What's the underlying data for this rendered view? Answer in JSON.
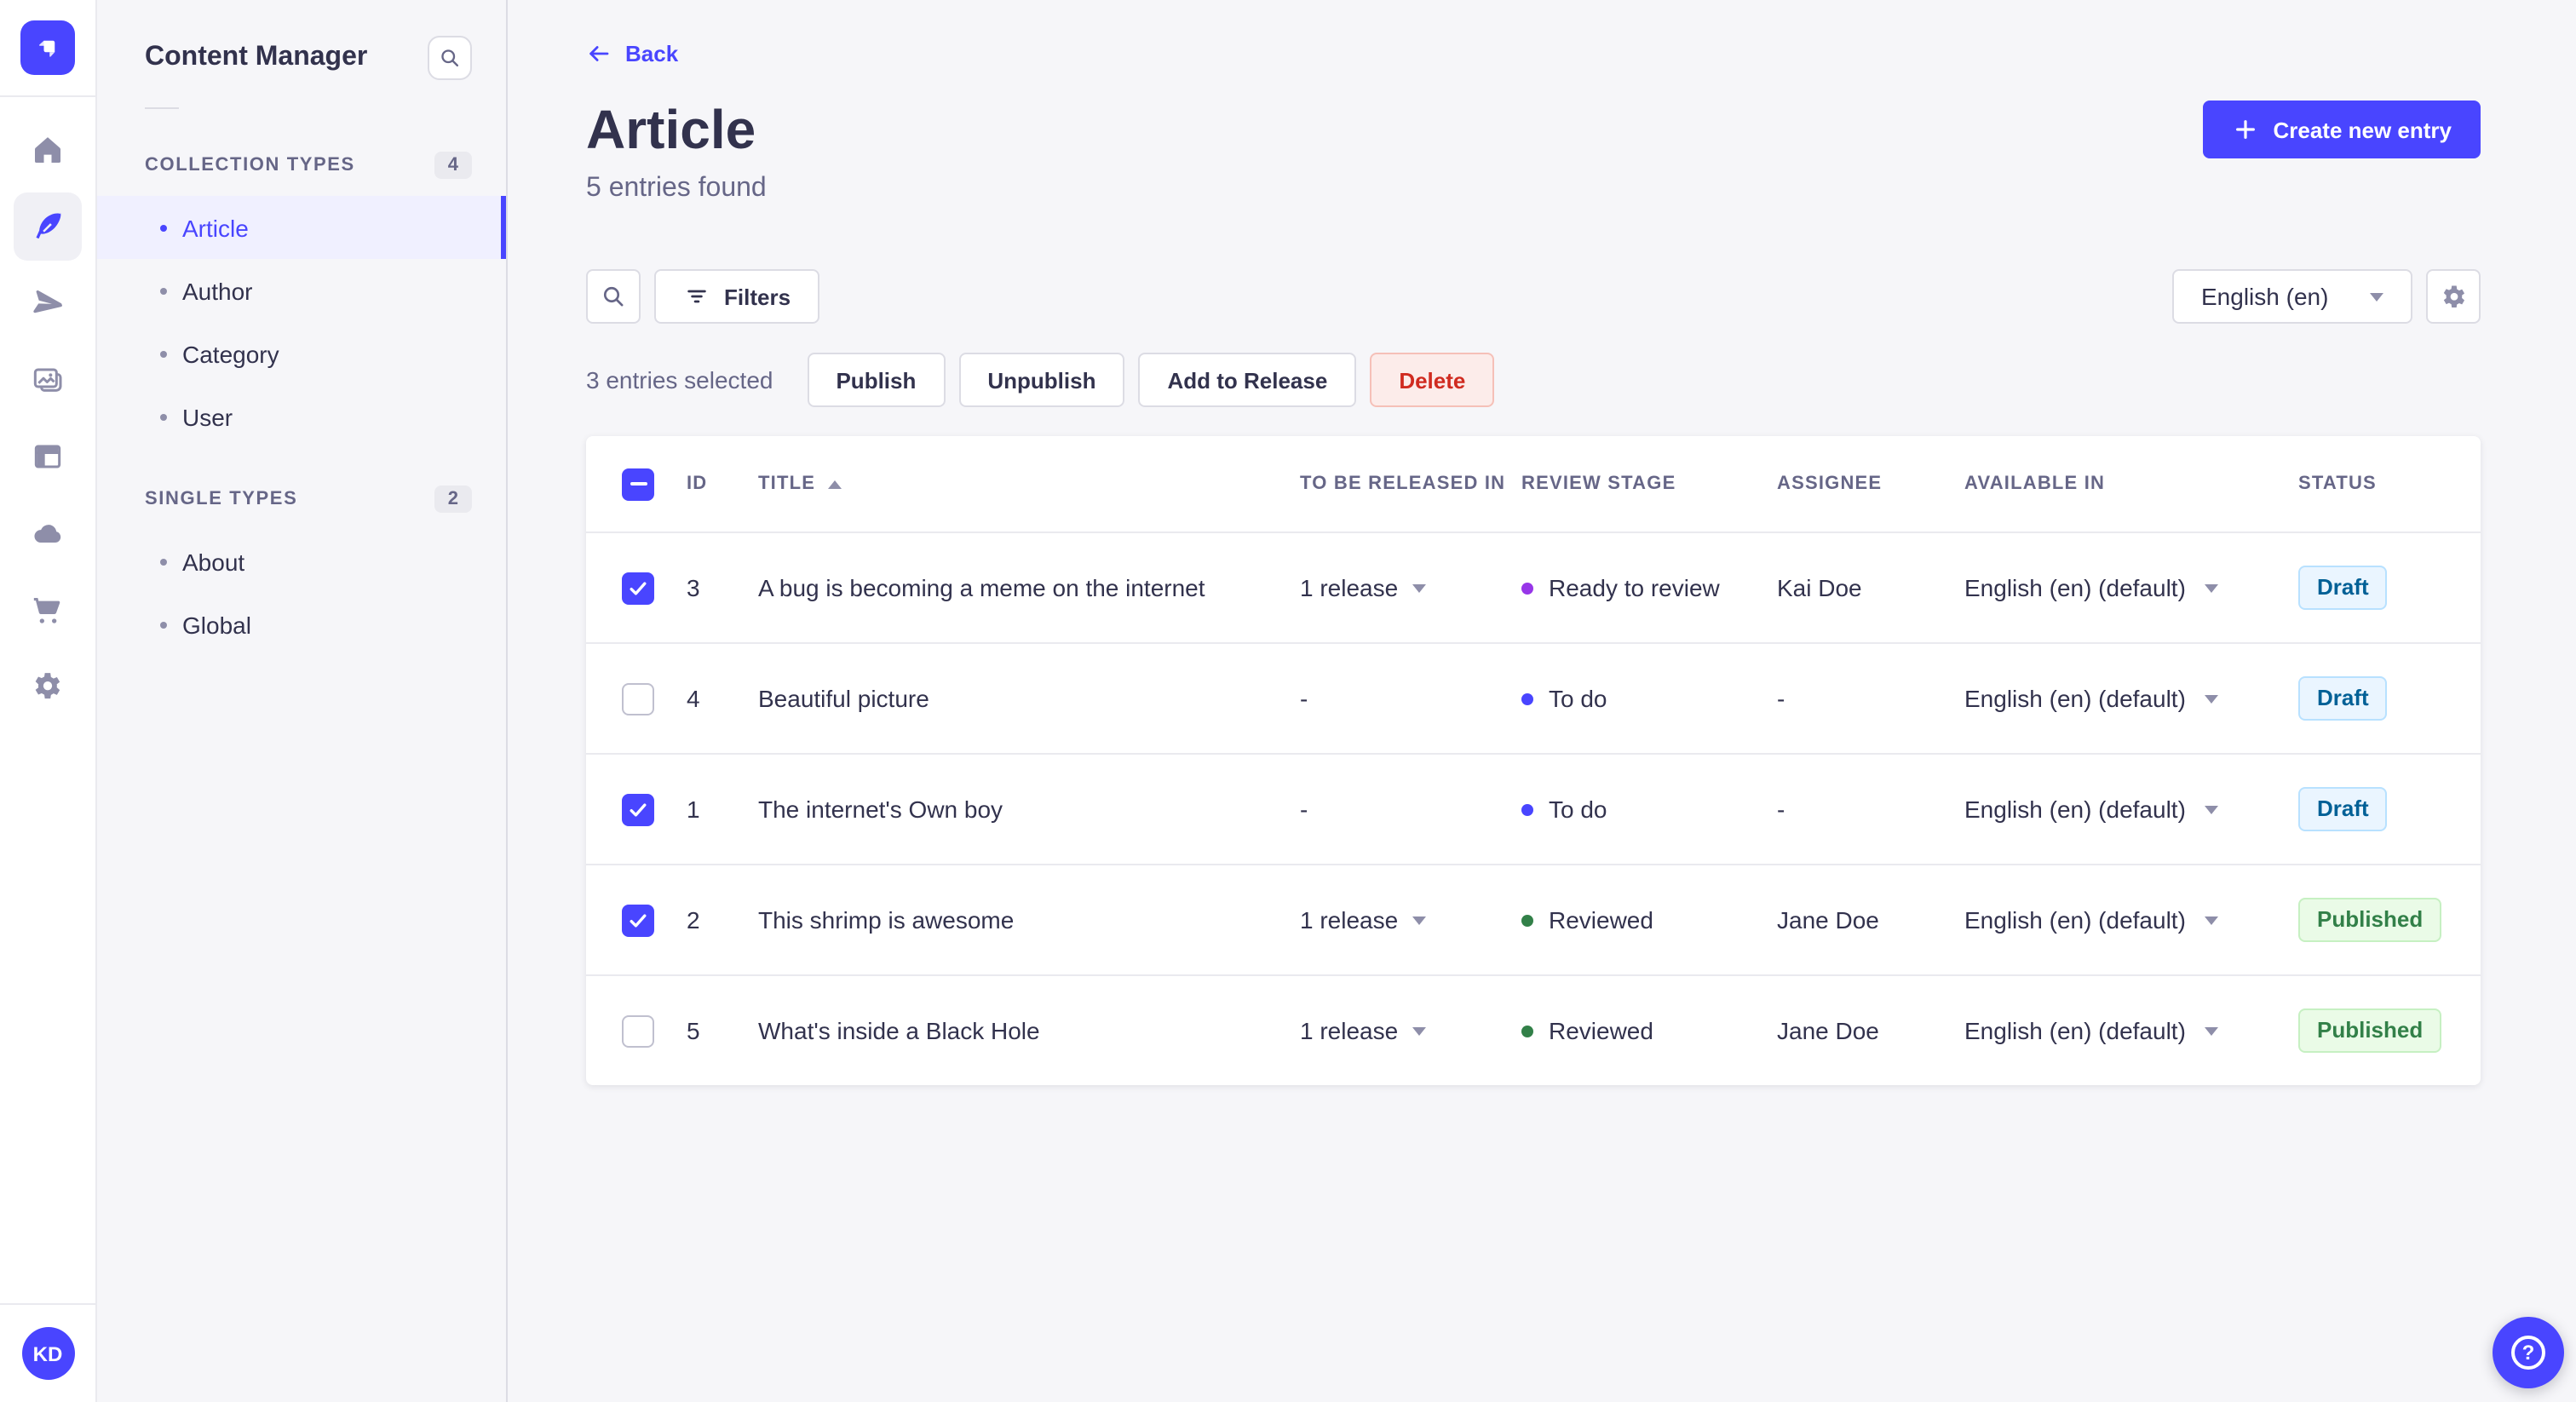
{
  "app": {
    "name": "Content Manager",
    "brand_color": "#4945ff"
  },
  "rail": {
    "items": [
      "home",
      "content-manager",
      "releases",
      "media-library",
      "content-type-builder",
      "deploy",
      "marketplace",
      "settings"
    ],
    "active_item": "content-manager",
    "avatar_initials": "KD"
  },
  "sidebar": {
    "title": "Content Manager",
    "collection": {
      "label": "COLLECTION TYPES",
      "count": "4",
      "items": [
        {
          "label": "Article",
          "state": "active"
        },
        {
          "label": "Author",
          "state": ""
        },
        {
          "label": "Category",
          "state": ""
        },
        {
          "label": "User",
          "state": ""
        }
      ]
    },
    "single": {
      "label": "SINGLE TYPES",
      "count": "2",
      "items": [
        {
          "label": "About",
          "state": ""
        },
        {
          "label": "Global",
          "state": ""
        }
      ]
    }
  },
  "header": {
    "back_label": "Back",
    "title": "Article",
    "subtitle": "5 entries found",
    "create_label": "Create new entry"
  },
  "toolbar": {
    "filters_label": "Filters",
    "locale_value": "English (en)"
  },
  "selection": {
    "summary": "3 entries selected",
    "publish_label": "Publish",
    "unpublish_label": "Unpublish",
    "add_to_release_label": "Add to Release",
    "delete_label": "Delete"
  },
  "table": {
    "headers": {
      "id": "ID",
      "title": "TITLE",
      "released": "TO BE RELEASED IN",
      "review": "REVIEW STAGE",
      "assignee": "ASSIGNEE",
      "available": "AVAILABLE IN",
      "status": "STATUS"
    },
    "sort": {
      "column": "TITLE",
      "direction": "asc"
    },
    "rows": [
      {
        "checked": true,
        "id": "3",
        "title": "A bug is becoming a meme on the internet",
        "release": "1 release",
        "release_menu": true,
        "stage": "Ready to review",
        "stage_color": "#9736e8",
        "assignee": "Kai Doe",
        "locale": "English (en) (default)",
        "status": "Draft",
        "status_variant": "draft"
      },
      {
        "checked": false,
        "id": "4",
        "title": "Beautiful picture",
        "release": "-",
        "release_menu": false,
        "stage": "To do",
        "stage_color": "#4945ff",
        "assignee": "-",
        "locale": "English (en) (default)",
        "status": "Draft",
        "status_variant": "draft"
      },
      {
        "checked": true,
        "id": "1",
        "title": "The internet's Own boy",
        "release": "-",
        "release_menu": false,
        "stage": "To do",
        "stage_color": "#4945ff",
        "assignee": "-",
        "locale": "English (en) (default)",
        "status": "Draft",
        "status_variant": "draft"
      },
      {
        "checked": true,
        "id": "2",
        "title": "This shrimp is awesome",
        "release": "1 release",
        "release_menu": true,
        "stage": "Reviewed",
        "stage_color": "#328048",
        "assignee": "Jane Doe",
        "locale": "English (en) (default)",
        "status": "Published",
        "status_variant": "published"
      },
      {
        "checked": false,
        "id": "5",
        "title": "What's inside a Black Hole",
        "release": "1 release",
        "release_menu": true,
        "stage": "Reviewed",
        "stage_color": "#328048",
        "assignee": "Jane Doe",
        "locale": "English (en) (default)",
        "status": "Published",
        "status_variant": "published"
      }
    ]
  },
  "fab": {
    "help_glyph": "?"
  },
  "colors": {
    "accent": "#4945ff",
    "sidebar_active_bg": "#f0f0ff",
    "danger_text": "#d02b20",
    "danger_bg": "#fcecea",
    "danger_border": "#f5c0b8",
    "draft_text": "#006096",
    "draft_bg": "#eaf5ff",
    "draft_border": "#b8e1ff",
    "published_text": "#328048",
    "published_bg": "#eafbe7",
    "published_border": "#c6f0c2",
    "stage_ready_to_review": "#9736e8",
    "stage_to_do": "#4945ff",
    "stage_reviewed": "#328048"
  }
}
